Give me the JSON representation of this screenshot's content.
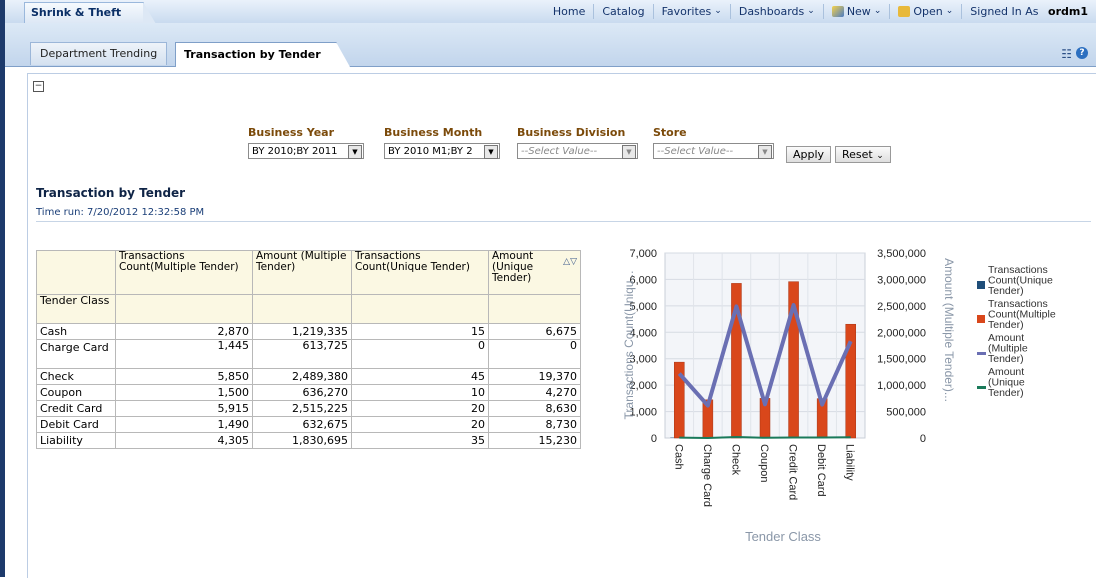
{
  "app": {
    "title": "Shrink & Theft"
  },
  "nav": {
    "home": "Home",
    "catalog": "Catalog",
    "favorites": "Favorites",
    "dashboards": "Dashboards",
    "new": "New",
    "open": "Open",
    "signed_in_label": "Signed In As",
    "user": "ordm1"
  },
  "tabs": [
    {
      "label": "Department Trending"
    },
    {
      "label": "Transaction by Tender"
    }
  ],
  "prompts": [
    {
      "label": "Business Year",
      "value": "BY 2010;BY 2011"
    },
    {
      "label": "Business Month",
      "value": "BY 2010 M1;BY 2"
    },
    {
      "label": "Business Division",
      "value": "--Select Value--"
    },
    {
      "label": "Store",
      "value": "--Select Value--"
    }
  ],
  "buttons": {
    "apply": "Apply",
    "reset": "Reset"
  },
  "report": {
    "title": "Transaction by Tender",
    "time_run": "Time run: 7/20/2012 12:32:58 PM"
  },
  "table": {
    "row_header": "Tender Class",
    "columns": [
      "Transactions Count(Multiple Tender)",
      "Amount (Multiple Tender)",
      "Transactions Count(Unique Tender)",
      "Amount (Unique Tender)"
    ],
    "rows": [
      {
        "label": "Cash",
        "values": [
          "2,870",
          "1,219,335",
          "15",
          "6,675"
        ]
      },
      {
        "label": "Charge Card",
        "values": [
          "1,445",
          "613,725",
          "0",
          "0"
        ]
      },
      {
        "label": "Check",
        "values": [
          "5,850",
          "2,489,380",
          "45",
          "19,370"
        ]
      },
      {
        "label": "Coupon",
        "values": [
          "1,500",
          "636,270",
          "10",
          "4,270"
        ]
      },
      {
        "label": "Credit Card",
        "values": [
          "5,915",
          "2,515,225",
          "20",
          "8,630"
        ]
      },
      {
        "label": "Debit Card",
        "values": [
          "1,490",
          "632,675",
          "20",
          "8,730"
        ]
      },
      {
        "label": "Liability",
        "values": [
          "4,305",
          "1,830,695",
          "35",
          "15,230"
        ]
      }
    ]
  },
  "colors": {
    "bar_multiple": "#d9471b",
    "bar_unique": "#1f4e79",
    "line_amount_multiple": "#6a6fb3",
    "line_amount_unique": "#1a7a5a",
    "header": "#0a2f66"
  },
  "chart_data": {
    "type": "bar",
    "categories": [
      "Cash",
      "Charge Card",
      "Check",
      "Coupon",
      "Credit Card",
      "Debit Card",
      "Liability"
    ],
    "series": [
      {
        "name": "Transactions Count(Unique Tender)",
        "kind": "bar",
        "axis": "left",
        "values": [
          15,
          0,
          45,
          10,
          20,
          20,
          35
        ]
      },
      {
        "name": "Transactions Count(Multiple Tender)",
        "kind": "bar",
        "axis": "left",
        "values": [
          2870,
          1445,
          5850,
          1500,
          5915,
          1490,
          4305
        ]
      },
      {
        "name": "Amount (Multiple Tender)",
        "kind": "line",
        "axis": "right",
        "values": [
          1219335,
          613725,
          2489380,
          636270,
          2515225,
          632675,
          1830695
        ]
      },
      {
        "name": "Amount (Unique Tender)",
        "kind": "line",
        "axis": "right",
        "values": [
          6675,
          0,
          19370,
          4270,
          8630,
          8730,
          15230
        ]
      }
    ],
    "xlabel": "Tender Class",
    "ylabel": "Transactions Count(Uniqu...",
    "y2label": "Amount (Multiple Tender)...",
    "ylim": [
      0,
      7000
    ],
    "y2lim": [
      0,
      3500000
    ],
    "yticks": [
      "0",
      "1,000",
      "2,000",
      "3,000",
      "4,000",
      "5,000",
      "6,000",
      "7,000"
    ],
    "y2ticks": [
      "0",
      "500,000",
      "1,000,000",
      "1,500,000",
      "2,000,000",
      "2,500,000",
      "3,000,000",
      "3,500,000"
    ],
    "legend": [
      "Transactions Count(Unique Tender)",
      "Transactions Count(Multiple Tender)",
      "Amount (Multiple Tender)",
      "Amount (Unique Tender)"
    ],
    "legend_position": "right"
  }
}
